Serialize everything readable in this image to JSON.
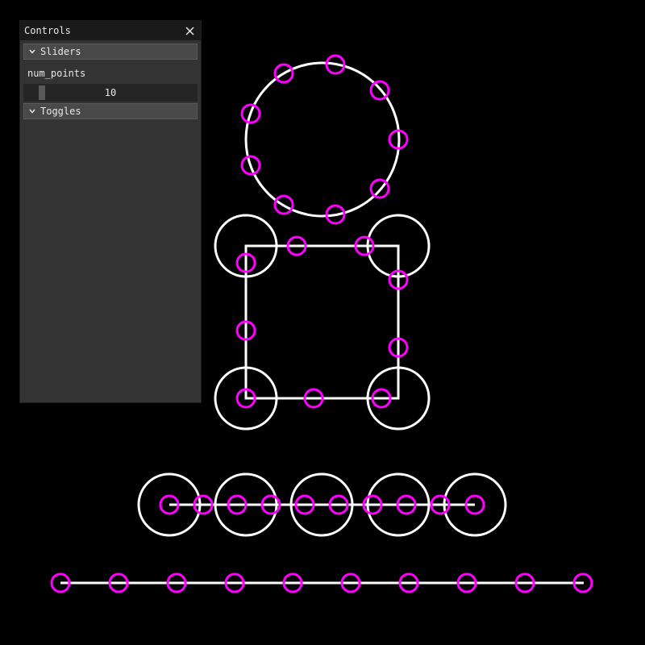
{
  "panel": {
    "title": "Controls",
    "sections": [
      {
        "label": "Sliders",
        "expanded": true
      },
      {
        "label": "Toggles",
        "expanded": false
      }
    ],
    "sliders": [
      {
        "label": "num_points",
        "value": "10",
        "fraction": 0.1
      }
    ]
  },
  "scene": {
    "background": "#000000",
    "shape_color": "#ffffff",
    "point_color": "#ff00ff"
  }
}
